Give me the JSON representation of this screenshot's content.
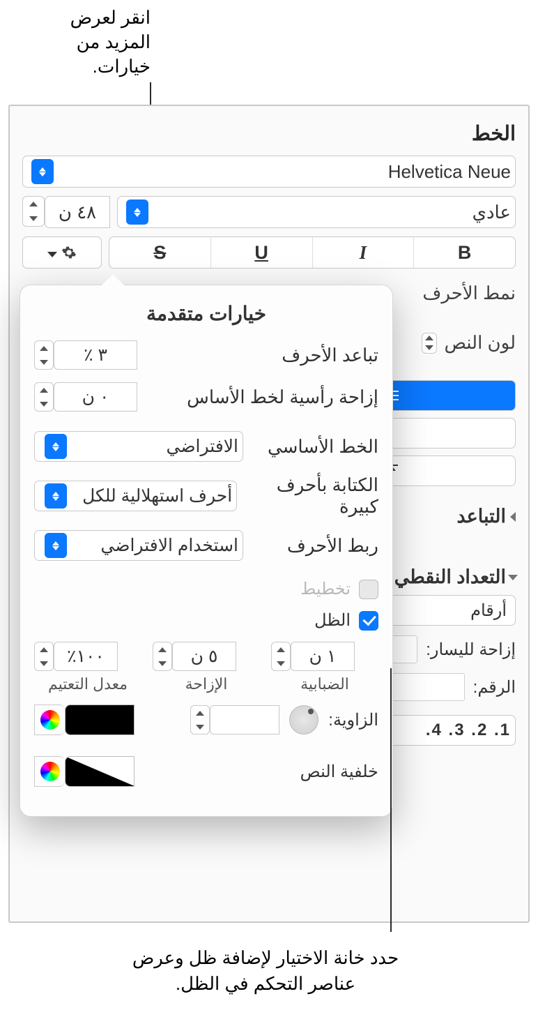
{
  "callouts": {
    "top": "انقر لعرض المزيد من خيارات.",
    "bottom_line1": "حدد خانة الاختيار لإضافة ظل وعرض",
    "bottom_line2": "عناصر التحكم في الظل."
  },
  "panel": {
    "section_font": "الخط",
    "font_family": "Helvetica Neue",
    "font_style": "عادي",
    "font_size": "٤٨ ن",
    "char_styles_label": "نمط الأحرف",
    "text_color_label": "لون النص",
    "spacing_label": "التباعد",
    "bullets_label": "التعداد النقطي",
    "bullets_type": "أرقام",
    "indent_left_label": "إزاحة لليسار:",
    "number_label": "الرقم:",
    "list_sequence": "1. 2. 3. 4."
  },
  "popover": {
    "title": "خيارات متقدمة",
    "char_spacing_label": "تباعد الأحرف",
    "char_spacing_value": "٣ ٪",
    "baseline_label": "إزاحة رأسية لخط الأساس",
    "baseline_value": "٠ ن",
    "baseline_opt_label": "الخط الأساسي",
    "baseline_opt_value": "الافتراضي",
    "caps_label": "الكتابة بأحرف كبيرة",
    "caps_value": "أحرف استهلالية للكل",
    "ligature_label": "ربط الأحرف",
    "ligature_value": "استخدام الافتراضي",
    "outline_label": "تخطيط",
    "shadow_label": "الظل",
    "blur_label": "الضبابية",
    "blur_value": "١ ن",
    "offset_label": "الإزاحة",
    "offset_value": "٥ ن",
    "opacity_label": "معدل التعتيم",
    "opacity_value": "١٠٠٪",
    "angle_label": "الزاوية:",
    "angle_value": "",
    "textbg_label": "خلفية النص"
  }
}
